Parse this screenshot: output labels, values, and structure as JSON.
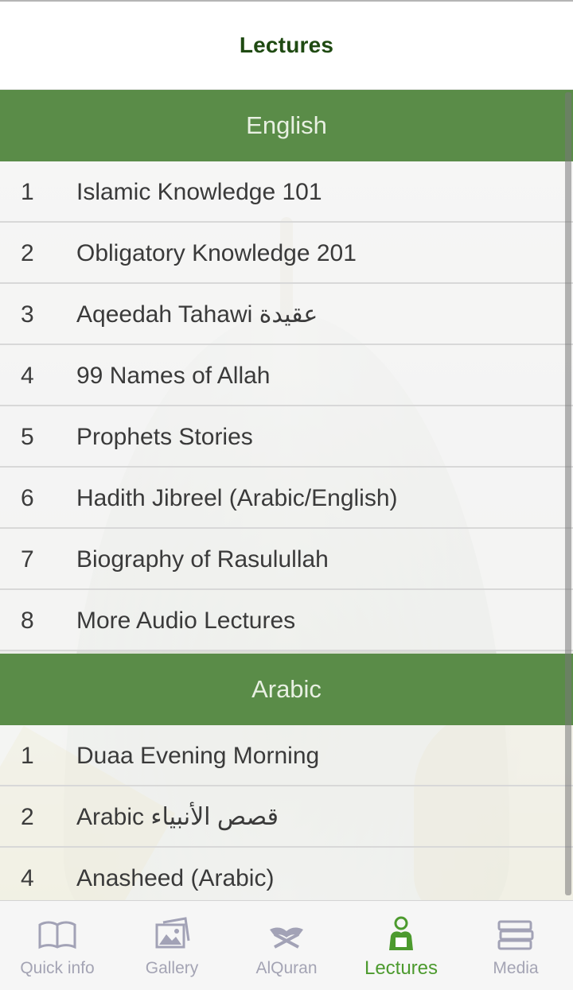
{
  "header": {
    "title": "Lectures"
  },
  "sections": [
    {
      "title": "English",
      "items": [
        {
          "num": "1",
          "label": "Islamic Knowledge 101"
        },
        {
          "num": "2",
          "label": "Obligatory Knowledge 201"
        },
        {
          "num": "3",
          "label": "Aqeedah Tahawi عقيدة"
        },
        {
          "num": "4",
          "label": "99 Names of Allah"
        },
        {
          "num": "5",
          "label": "Prophets Stories"
        },
        {
          "num": "6",
          "label": "Hadith Jibreel (Arabic/English)"
        },
        {
          "num": "7",
          "label": "Biography of Rasulullah"
        },
        {
          "num": "8",
          "label": "More Audio Lectures"
        }
      ]
    },
    {
      "title": "Arabic",
      "items": [
        {
          "num": "1",
          "label": "Duaa Evening Morning"
        },
        {
          "num": "2",
          "label": "Arabic قصص الأنبياء"
        },
        {
          "num": "4",
          "label": "Anasheed (Arabic)"
        }
      ]
    }
  ],
  "tabbar": {
    "active": "Lectures",
    "tabs": [
      {
        "label": "Quick info",
        "icon": "book-icon"
      },
      {
        "label": "Gallery",
        "icon": "gallery-icon"
      },
      {
        "label": "AlQuran",
        "icon": "quran-icon"
      },
      {
        "label": "Lectures",
        "icon": "reader-icon"
      },
      {
        "label": "Media",
        "icon": "books-stack-icon"
      }
    ]
  },
  "colors": {
    "section_bg": "#5a8c48",
    "title_text": "#1f4a12",
    "active_tab": "#4c9a2e",
    "inactive_tab": "#a4a4b4"
  }
}
